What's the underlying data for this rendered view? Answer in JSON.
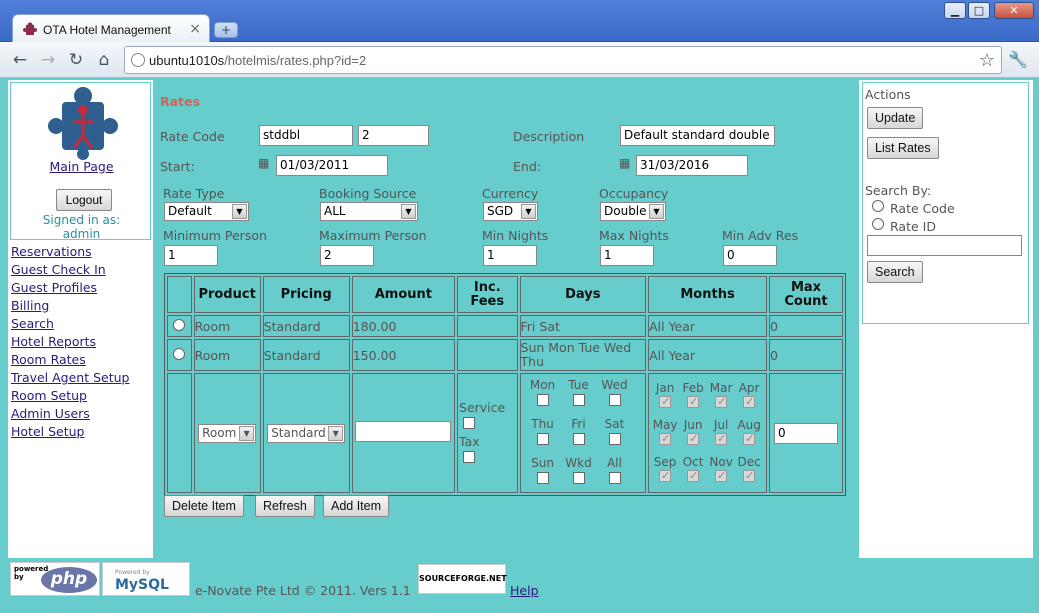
{
  "browser": {
    "tab_title": "OTA Hotel Management",
    "tab_close": "×",
    "new_tab": "+",
    "url_host": "ubuntu1010s",
    "url_path": "/hotelmis/rates.php?id=2",
    "back_icon": "arrow-left",
    "forward_icon": "arrow-right",
    "reload_icon": "reload",
    "home_icon": "home",
    "star_icon": "star",
    "wrench_icon": "wrench",
    "win_minimize": "▁",
    "win_maximize": "□",
    "win_close": "✕"
  },
  "sidebar": {
    "main_page": "Main Page",
    "logout": "Logout",
    "signed_in_as": "Signed in as:",
    "user": "admin",
    "links": [
      "Reservations",
      "Guest Check In",
      "Guest Profiles",
      "Billing",
      "Search",
      "Hotel Reports",
      "Room Rates",
      "Travel Agent Setup",
      "Room Setup",
      "Admin Users",
      "Hotel Setup"
    ]
  },
  "form": {
    "title": "Rates",
    "rate_code_label": "Rate Code",
    "rate_code": "stddbl",
    "rate_id": "2",
    "description_label": "Description",
    "description": "Default standard double ro",
    "start_label": "Start:",
    "start": "01/03/2011",
    "end_label": "End:",
    "end": "31/03/2016",
    "rate_type_label": "Rate Type",
    "rate_type": "Default",
    "booking_source_label": "Booking Source",
    "booking_source": "ALL",
    "currency_label": "Currency",
    "currency": "SGD",
    "occupancy_label": "Occupancy",
    "occupancy": "Double",
    "min_person_label": "Minimum Person",
    "min_person": "1",
    "max_person_label": "Maximum Person",
    "max_person": "2",
    "min_nights_label": "Min Nights",
    "min_nights": "1",
    "max_nights_label": "Max Nights",
    "max_nights": "1",
    "min_adv_label": "Min Adv Res",
    "min_adv": "0"
  },
  "table": {
    "headers": [
      "Product",
      "Pricing",
      "Amount",
      "Inc.\nFees",
      "Days",
      "Months",
      "Max\nCount"
    ],
    "rows": [
      {
        "product": "Room",
        "pricing": "Standard",
        "amount": "180.00",
        "fees": "",
        "days": "Fri Sat",
        "months": "All Year",
        "max_count": "0"
      },
      {
        "product": "Room",
        "pricing": "Standard",
        "amount": "150.00",
        "fees": "",
        "days": "Sun Mon Tue Wed Thu",
        "months": "All Year",
        "max_count": "0"
      }
    ],
    "new_row": {
      "product": "Room",
      "pricing": "Standard",
      "amount": "",
      "service_label": "Service",
      "tax_label": "Tax",
      "days": [
        "Mon",
        "Tue",
        "Wed",
        "Thu",
        "Fri",
        "Sat",
        "Sun",
        "Wkd",
        "All"
      ],
      "months": [
        "Jan",
        "Feb",
        "Mar",
        "Apr",
        "May",
        "Jun",
        "Jul",
        "Aug",
        "Sep",
        "Oct",
        "Nov",
        "Dec"
      ],
      "max_count": "0"
    }
  },
  "buttons": {
    "delete_item": "Delete Item",
    "refresh": "Refresh",
    "add_item": "Add Item"
  },
  "actions": {
    "title": "Actions",
    "update": "Update",
    "list_rates": "List Rates",
    "search_by": "Search By:",
    "opt_rate_code": "Rate Code",
    "opt_rate_id": "Rate ID",
    "search_value": "",
    "search": "Search"
  },
  "footer": {
    "powered_by": "powered by",
    "php": "php",
    "mysql_small": "Powered by",
    "mysql": "MySQL",
    "copyright": "e-Novate Pte Ltd © 2011. Vers 1.1",
    "sourceforge": "SOURCEFORGE.NET",
    "help": "Help"
  }
}
